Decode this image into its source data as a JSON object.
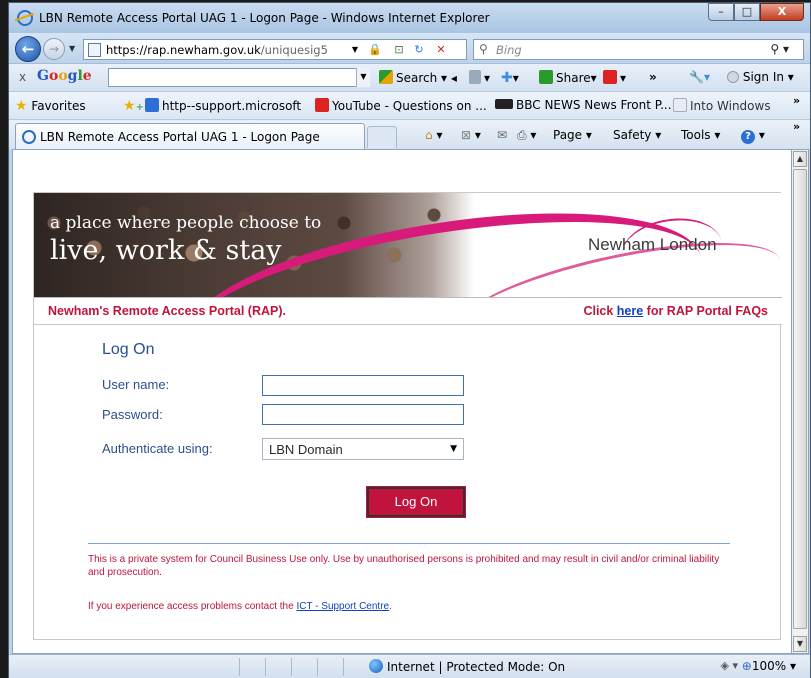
{
  "window": {
    "title": "LBN Remote Access Portal UAG 1 - Logon Page - Windows Internet Explorer",
    "minimize": "–",
    "maximize": "□",
    "close": "X"
  },
  "nav": {
    "url_host": "https://rap.newham.gov.uk",
    "url_path": "/uniquesig5",
    "search_placeholder": "Bing"
  },
  "google_toolbar": {
    "close": "x",
    "logo": "Google",
    "search": "Search",
    "share": "Share",
    "more": "»",
    "sign_in": "Sign In"
  },
  "favorites": {
    "label": "Favorites",
    "items": [
      "http--support.microsoft",
      "YouTube - Questions on ...",
      "BBC NEWS  News Front P...",
      "Into Windows"
    ],
    "overflow": "»"
  },
  "tab": {
    "label": "LBN Remote Access Portal UAG 1 - Logon Page"
  },
  "commands": {
    "page": "Page",
    "safety": "Safety",
    "tools": "Tools",
    "overflow": "»"
  },
  "banner": {
    "tagline_small": "a place where people choose to",
    "tagline_large": "live, work & stay",
    "logo": "Newham London"
  },
  "subheader": {
    "left": "Newham's Remote Access Portal (RAP).",
    "right_prefix": "Click ",
    "right_link": "here",
    "right_suffix": " for RAP Portal FAQs"
  },
  "form": {
    "title": "Log On",
    "username_label": "User name:",
    "username_value": "",
    "password_label": "Password:",
    "password_value": "",
    "auth_label": "Authenticate using:",
    "auth_value": "LBN Domain",
    "button": "Log On"
  },
  "footer": {
    "notice": "This is a private system for Council Business Use only. Use by unauthorised persons is prohibited and may result in civil and/or criminal liability and prosecution.",
    "contact_prefix": "If you experience access problems contact the ",
    "contact_link": "ICT - Support Centre",
    "contact_suffix": "."
  },
  "status": {
    "zone": "Internet | Protected Mode: On",
    "zoom": "100%"
  },
  "colors": {
    "brand": "#c0143c",
    "link": "#1040c0",
    "label": "#2b4f8f",
    "swoosh": "#d81b7a"
  }
}
